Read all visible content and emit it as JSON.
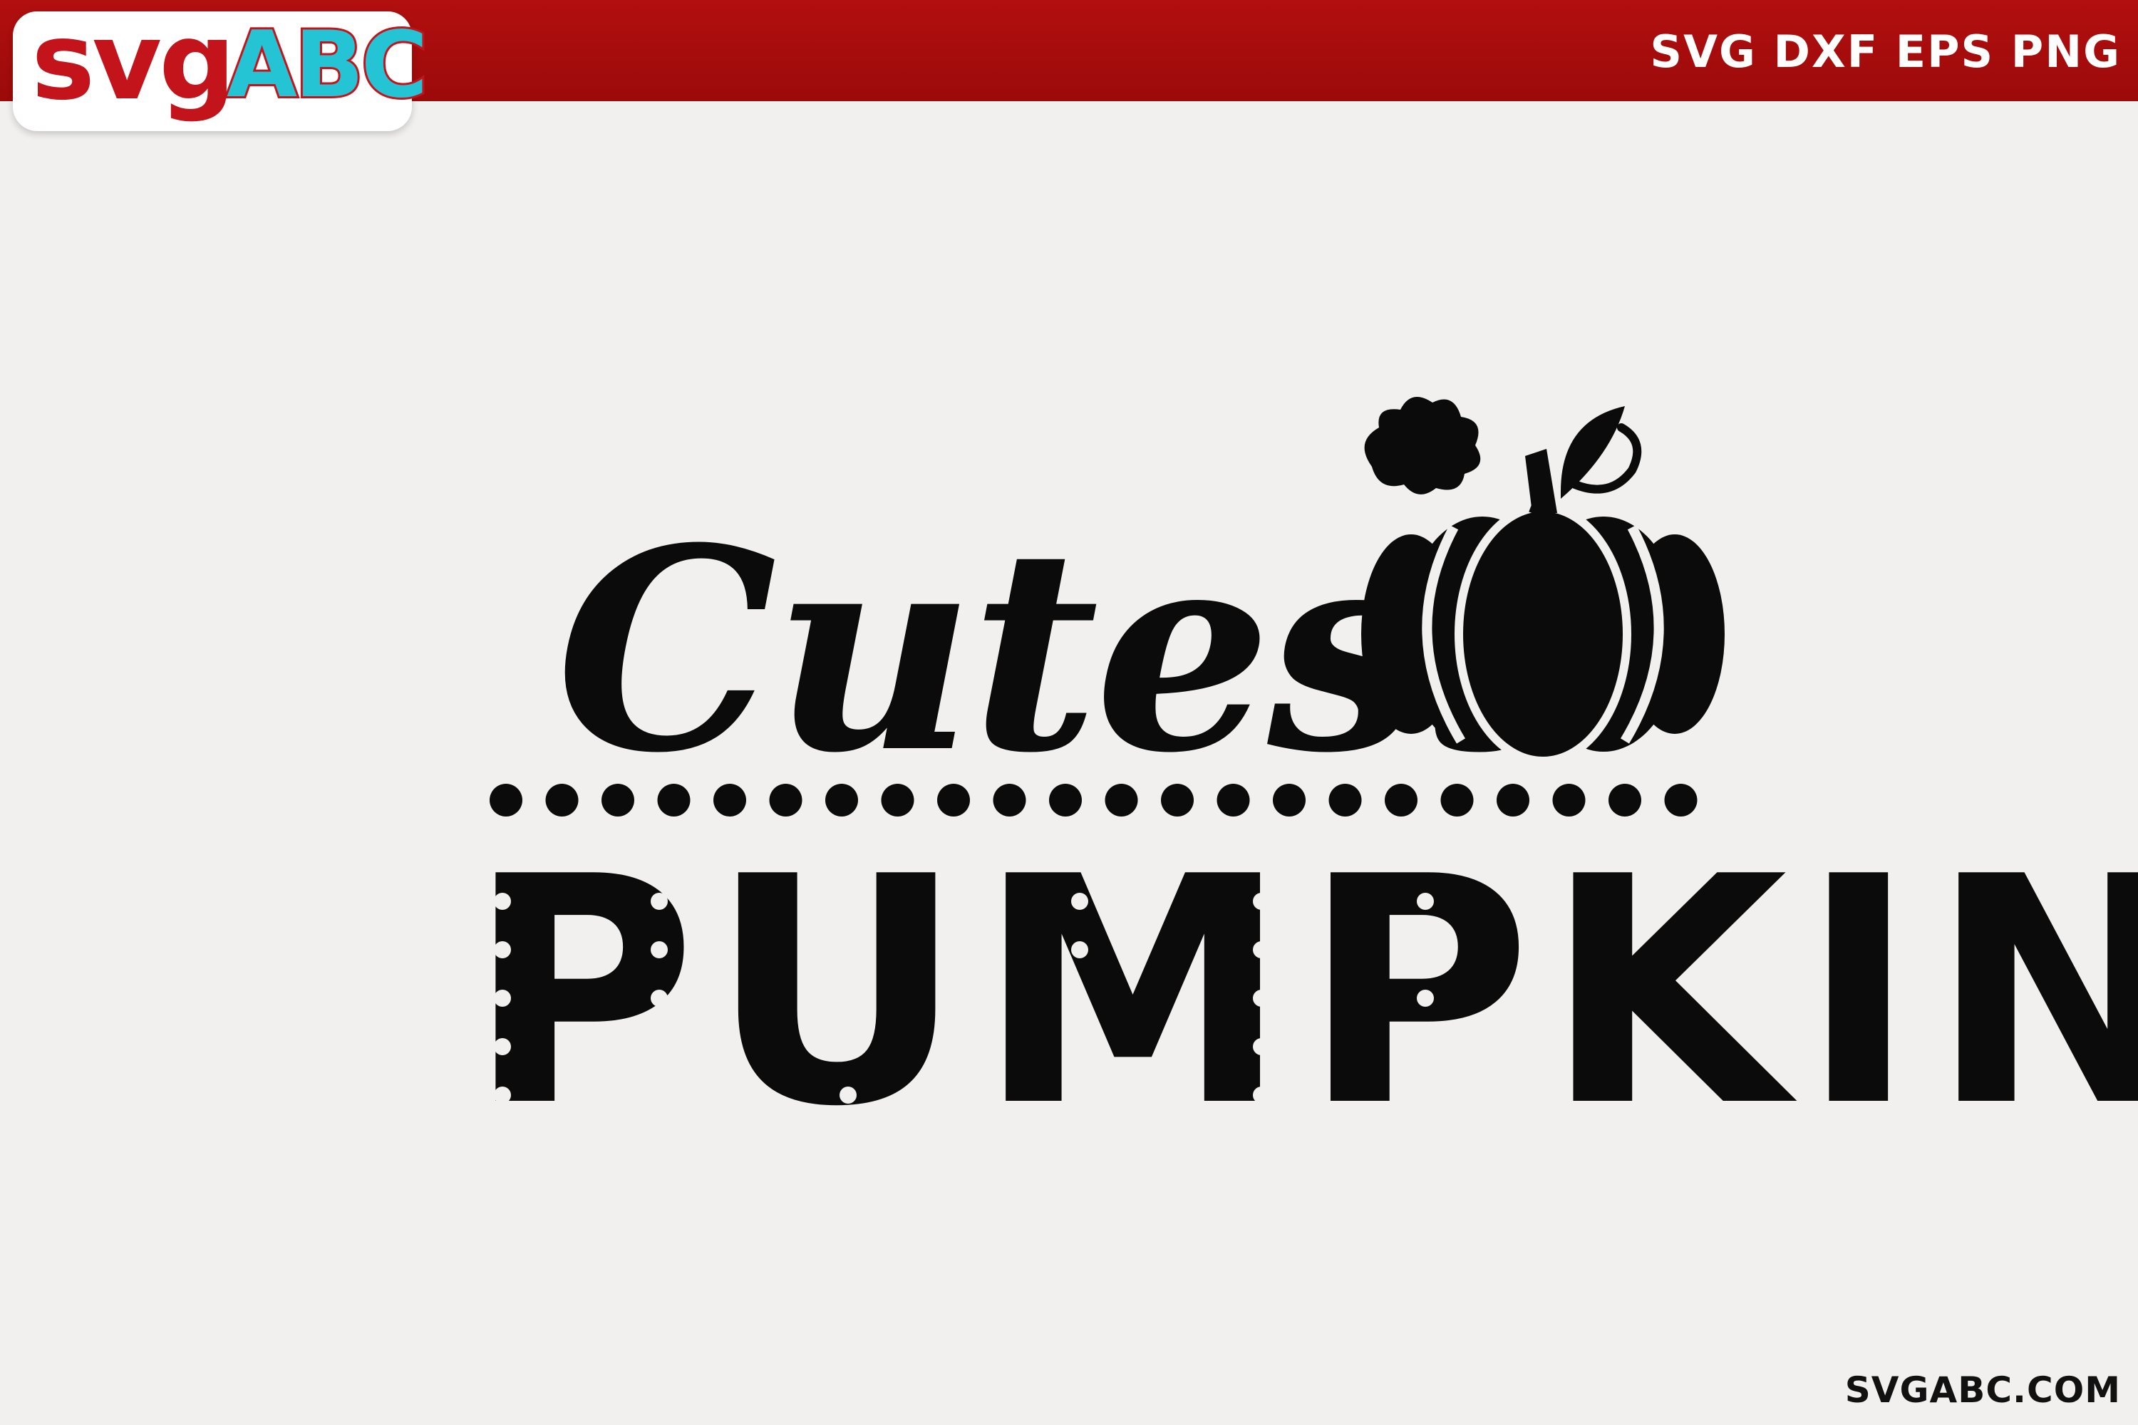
{
  "banner": {
    "logo_part1": "svg",
    "logo_part2": "ABC",
    "formats": "SVG DXF EPS PNG",
    "bar_color": "#a50d0d",
    "logo_red": "#c3141c",
    "logo_cyan": "#24c4d4"
  },
  "design": {
    "line1": "Cutest",
    "line2": "PUMPKIN",
    "ink_color": "#0b0b0b",
    "icon": "pumpkin-icon",
    "divider": "dotted-line"
  },
  "footer": {
    "website": "SVGABC.COM"
  }
}
